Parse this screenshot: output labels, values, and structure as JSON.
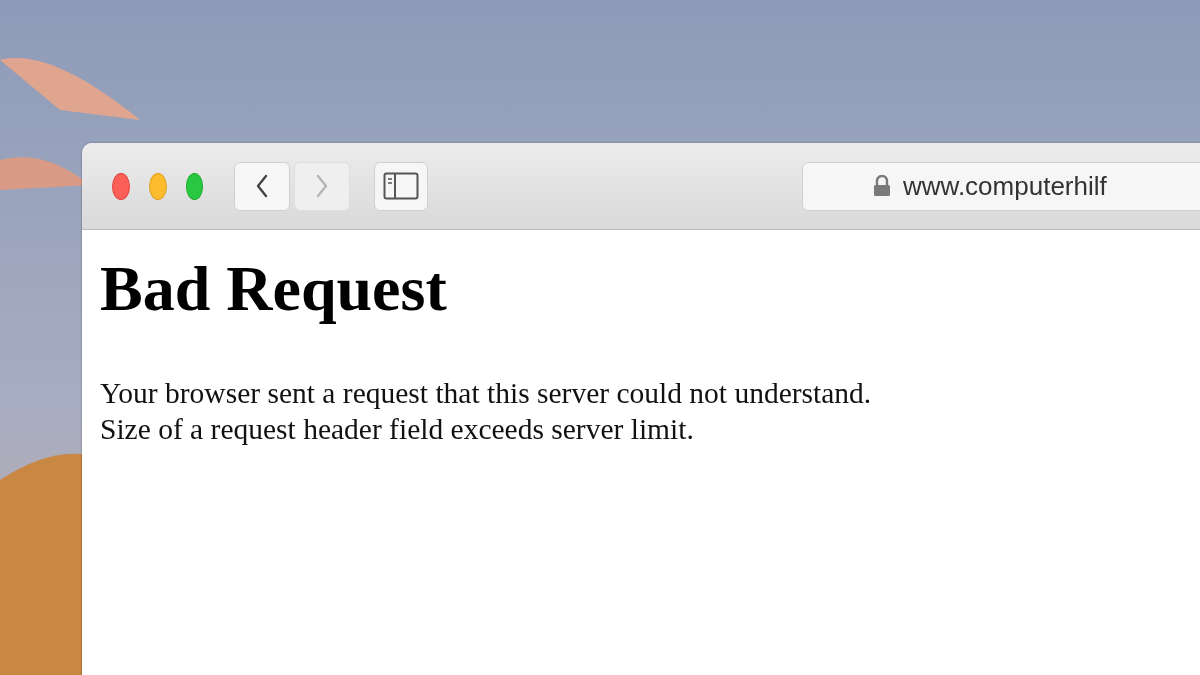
{
  "browser": {
    "nav_buttons": [
      {
        "kind": "back",
        "disabled": false
      },
      {
        "kind": "forward",
        "disabled": true
      }
    ],
    "address": {
      "value": "www.computerhilf",
      "secure": true
    }
  },
  "page": {
    "heading": "Bad Request",
    "lines": [
      "Your browser sent a request that this server could not understand.",
      "Size of a request header field exceeds server limit."
    ]
  }
}
